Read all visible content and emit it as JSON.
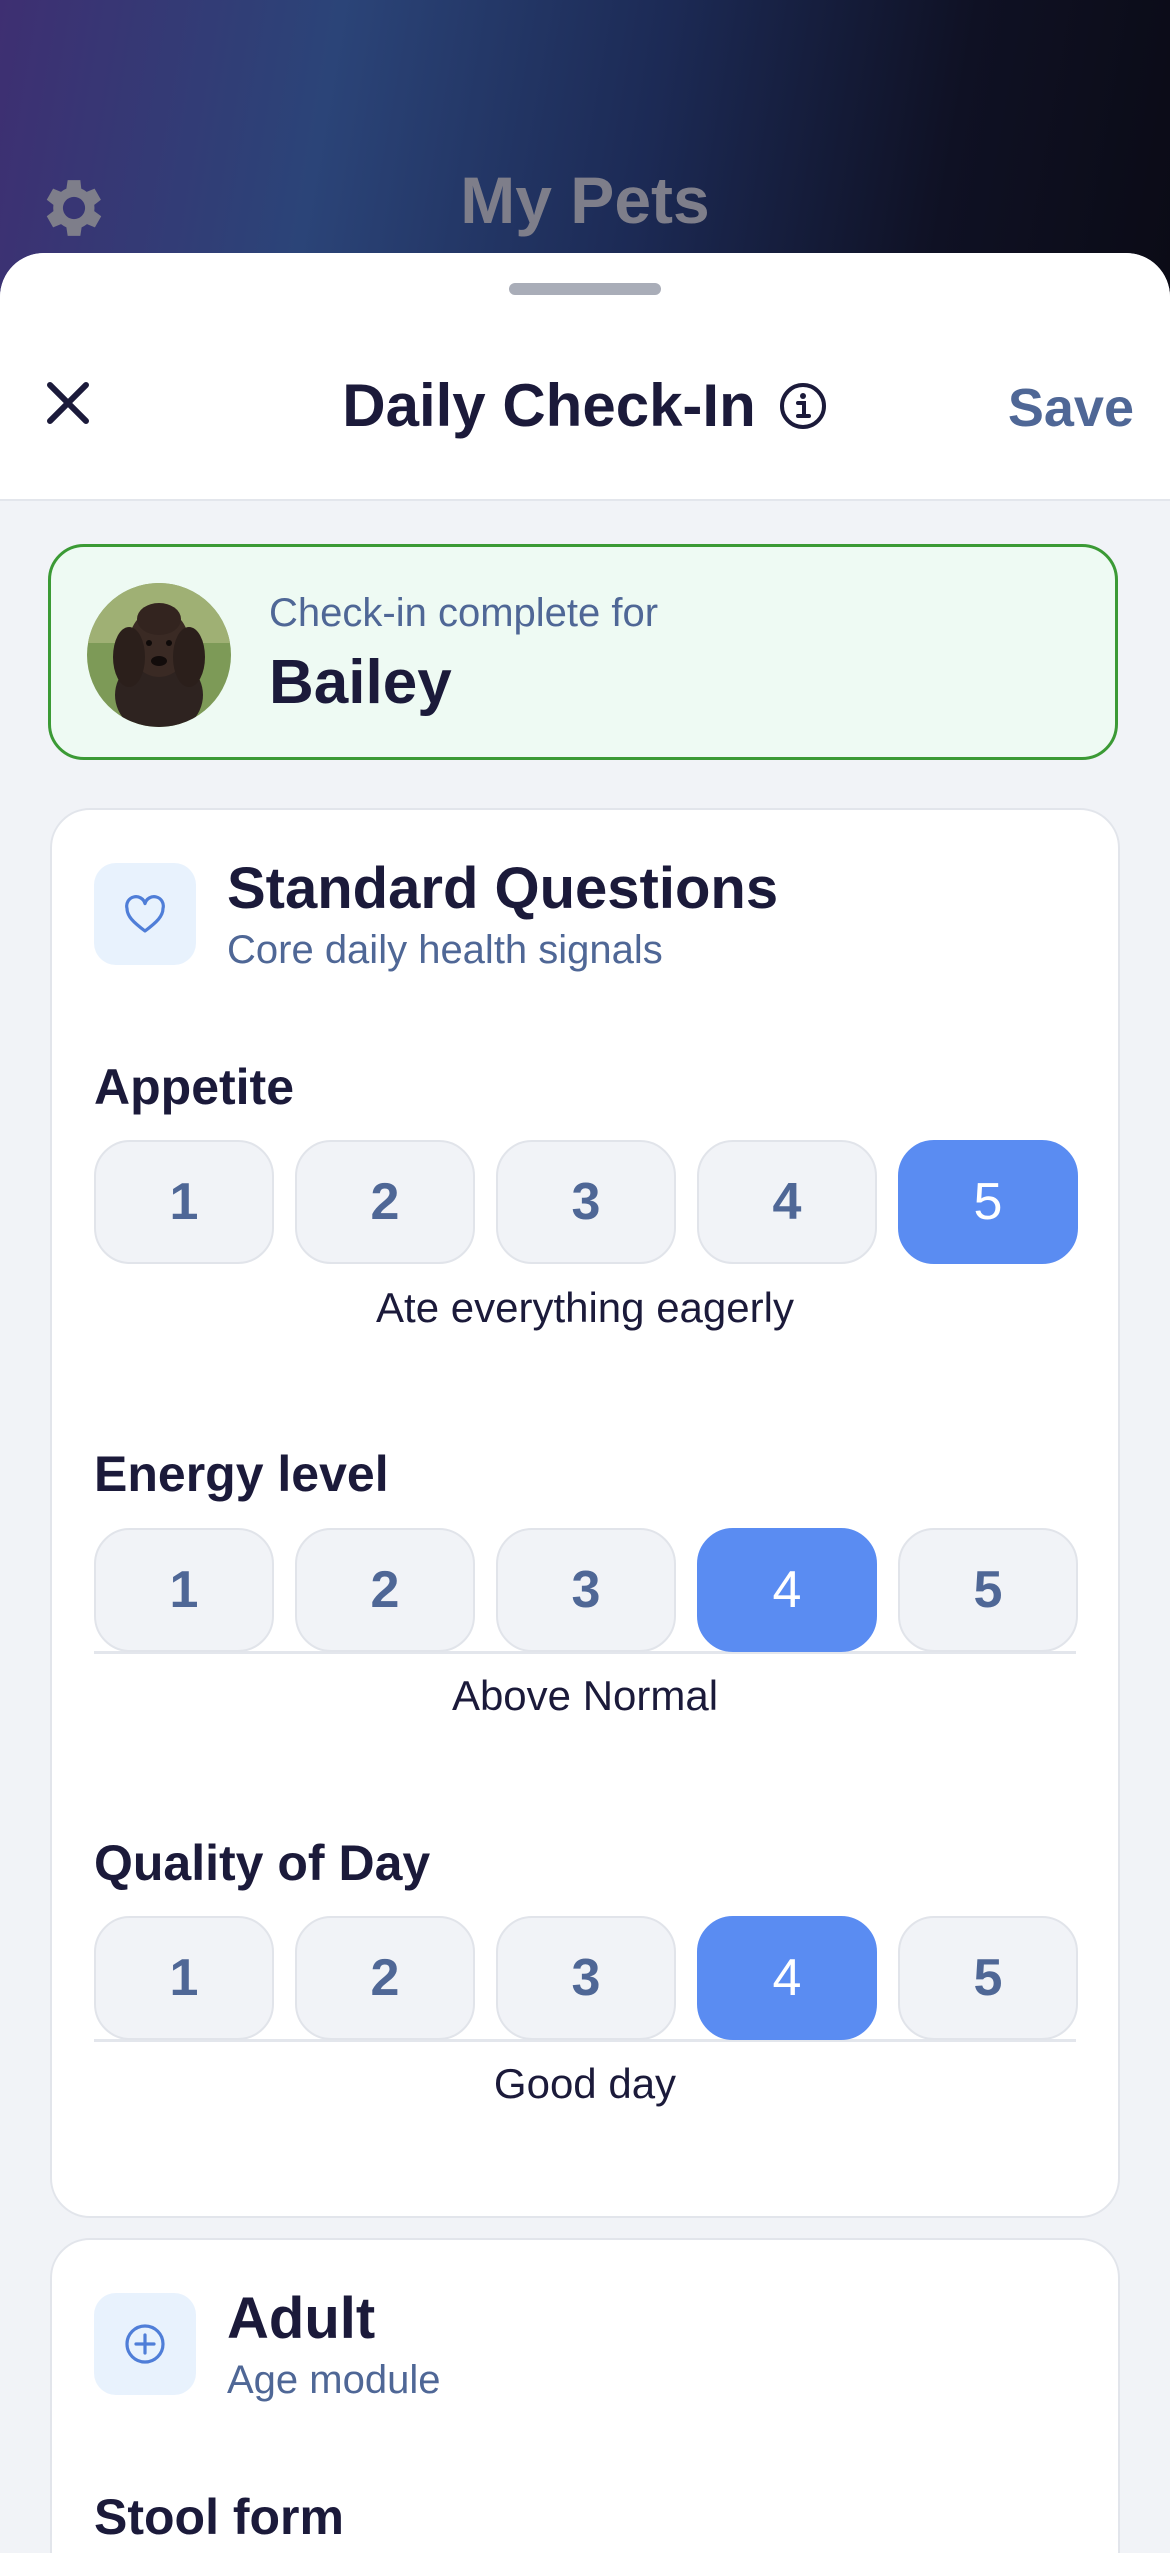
{
  "background": {
    "title": "My Pets",
    "settings_icon": "gear-icon"
  },
  "sheet": {
    "title": "Daily Check-In",
    "close_icon": "close-icon",
    "info_icon": "info-icon",
    "save_label": "Save"
  },
  "banner": {
    "subtitle": "Check-in complete for",
    "pet_name": "Bailey"
  },
  "standard": {
    "icon": "heart-icon",
    "title": "Standard Questions",
    "subtitle": "Core daily health signals",
    "questions": [
      {
        "label": "Appetite",
        "options": [
          "1",
          "2",
          "3",
          "4",
          "5"
        ],
        "selected": "5",
        "description": "Ate everything eagerly"
      },
      {
        "label": "Energy level",
        "options": [
          "1",
          "2",
          "3",
          "4",
          "5"
        ],
        "selected": "4",
        "description": "Above Normal"
      },
      {
        "label": "Quality of Day",
        "options": [
          "1",
          "2",
          "3",
          "4",
          "5"
        ],
        "selected": "4",
        "description": "Good day"
      }
    ]
  },
  "adult": {
    "icon": "plus-circle-icon",
    "title": "Adult",
    "subtitle": "Age module",
    "next_question_partial": "Stool form"
  },
  "colors": {
    "accent": "#5a8cf2",
    "banner_border": "#3b9a35",
    "banner_bg": "#eefaf3",
    "text_dark": "#1b1a3a",
    "text_muted": "#4f6796"
  }
}
